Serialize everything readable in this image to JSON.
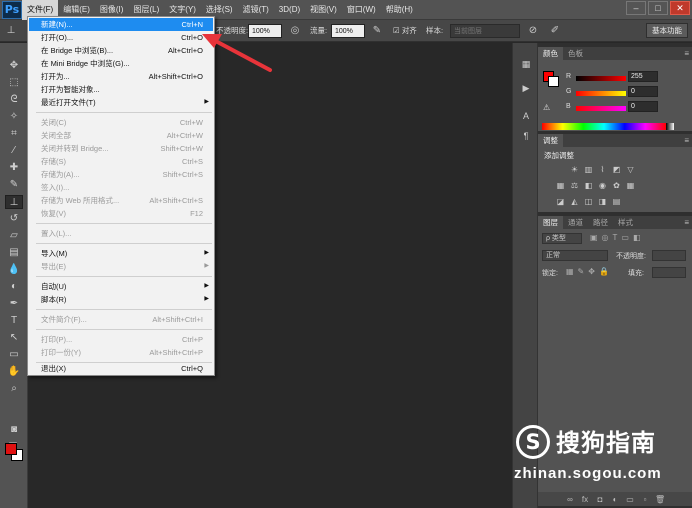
{
  "app": {
    "logo": "Ps"
  },
  "menubar": {
    "items": [
      "文件(F)",
      "编辑(E)",
      "图像(I)",
      "图层(L)",
      "文字(Y)",
      "选择(S)",
      "滤镜(T)",
      "3D(D)",
      "视图(V)",
      "窗口(W)",
      "帮助(H)"
    ],
    "window_controls": [
      "–",
      "□",
      "✕"
    ]
  },
  "optionsbar": {
    "opacity_label": "不透明度:",
    "opacity_value": "100%",
    "flow_label": "流量:",
    "flow_value": "100%",
    "align_label": "对齐",
    "sample_label": "样本:",
    "sample_value": "当前图层",
    "workspace": "基本功能"
  },
  "file_menu": {
    "items": [
      {
        "label": "新建(N)...",
        "shortcut": "Ctrl+N",
        "state": "highlight"
      },
      {
        "label": "打开(O)...",
        "shortcut": "Ctrl+O",
        "state": "normal"
      },
      {
        "label": "在 Bridge 中浏览(B)...",
        "shortcut": "Alt+Ctrl+O",
        "state": "normal"
      },
      {
        "label": "在 Mini Bridge 中浏览(G)...",
        "shortcut": "",
        "state": "normal"
      },
      {
        "label": "打开为...",
        "shortcut": "Alt+Shift+Ctrl+O",
        "state": "normal"
      },
      {
        "label": "打开为智能对象...",
        "shortcut": "",
        "state": "normal"
      },
      {
        "label": "最近打开文件(T)",
        "shortcut": "",
        "state": "normal",
        "submenu": true
      },
      {
        "label": "关闭(C)",
        "shortcut": "Ctrl+W",
        "state": "disabled"
      },
      {
        "label": "关闭全部",
        "shortcut": "Alt+Ctrl+W",
        "state": "disabled"
      },
      {
        "label": "关闭并转到 Bridge...",
        "shortcut": "Shift+Ctrl+W",
        "state": "disabled"
      },
      {
        "label": "存储(S)",
        "shortcut": "Ctrl+S",
        "state": "disabled"
      },
      {
        "label": "存储为(A)...",
        "shortcut": "Shift+Ctrl+S",
        "state": "disabled"
      },
      {
        "label": "签入(I)...",
        "shortcut": "",
        "state": "disabled"
      },
      {
        "label": "存储为 Web 所用格式...",
        "shortcut": "Alt+Shift+Ctrl+S",
        "state": "disabled"
      },
      {
        "label": "恢复(V)",
        "shortcut": "F12",
        "state": "disabled"
      },
      {
        "label": "置入(L)...",
        "shortcut": "",
        "state": "disabled"
      },
      {
        "label": "导入(M)",
        "shortcut": "",
        "state": "normal",
        "submenu": true
      },
      {
        "label": "导出(E)",
        "shortcut": "",
        "state": "disabled",
        "submenu": true
      },
      {
        "label": "自动(U)",
        "shortcut": "",
        "state": "normal",
        "submenu": true
      },
      {
        "label": "脚本(R)",
        "shortcut": "",
        "state": "normal",
        "submenu": true
      },
      {
        "label": "文件简介(F)...",
        "shortcut": "Alt+Shift+Ctrl+I",
        "state": "disabled"
      },
      {
        "label": "打印(P)...",
        "shortcut": "Ctrl+P",
        "state": "disabled"
      },
      {
        "label": "打印一份(Y)",
        "shortcut": "Alt+Shift+Ctrl+P",
        "state": "disabled"
      },
      {
        "label": "退出(X)",
        "shortcut": "Ctrl+Q",
        "state": "normal"
      }
    ]
  },
  "color_panel": {
    "tabs": [
      "颜色",
      "色板"
    ],
    "channels": [
      {
        "label": "R",
        "value": "255"
      },
      {
        "label": "G",
        "value": "0"
      },
      {
        "label": "B",
        "value": "0"
      }
    ],
    "foreground": "#ff0000"
  },
  "adjust_panel": {
    "tabs": [
      "调整"
    ],
    "title": "添加调整"
  },
  "layers_panel": {
    "tabs": [
      "图层",
      "通道",
      "路径",
      "样式"
    ],
    "filter_kind": "ρ 类型",
    "blend_mode": "正常",
    "opacity_label": "不透明度:",
    "lock_label": "锁定:",
    "fill_label": "填充:"
  },
  "watermark": {
    "logo_letter": "S",
    "name": "搜狗指南",
    "url": "zhinan.sogou.com"
  },
  "colors": {
    "highlight": "#1e8cf0",
    "arrow": "#e8343a",
    "foreground_swatch": "#e01010"
  }
}
